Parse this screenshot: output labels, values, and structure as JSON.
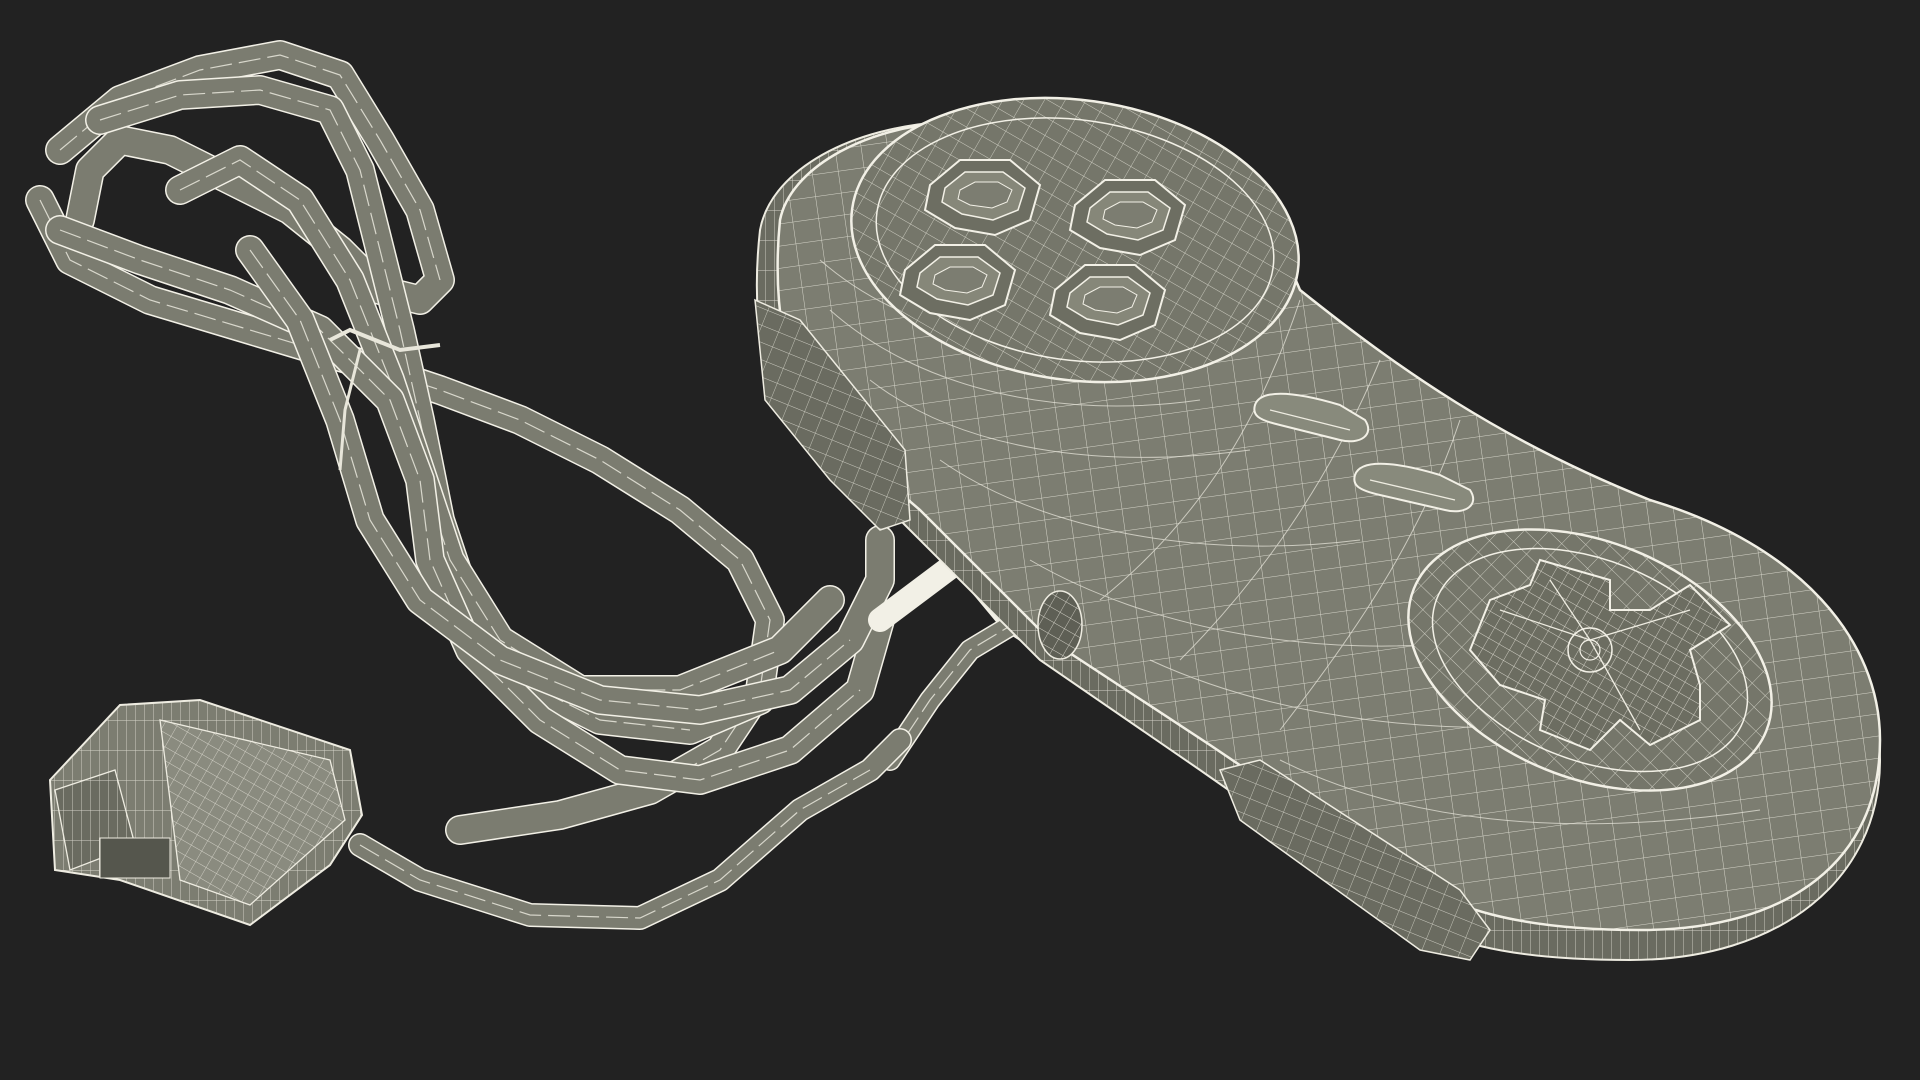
{
  "scene": {
    "subject": "game-controller-wireframe",
    "colors": {
      "background": "#222222",
      "surface": "#7c7d71",
      "surface_dark": "#5f6056",
      "surface_light": "#8d8e82",
      "wire": "#eeece1"
    },
    "parts": [
      "controller-body",
      "face-buttons",
      "d-pad",
      "select-start-buttons",
      "shoulder-buttons",
      "cable",
      "connector-plug"
    ]
  }
}
